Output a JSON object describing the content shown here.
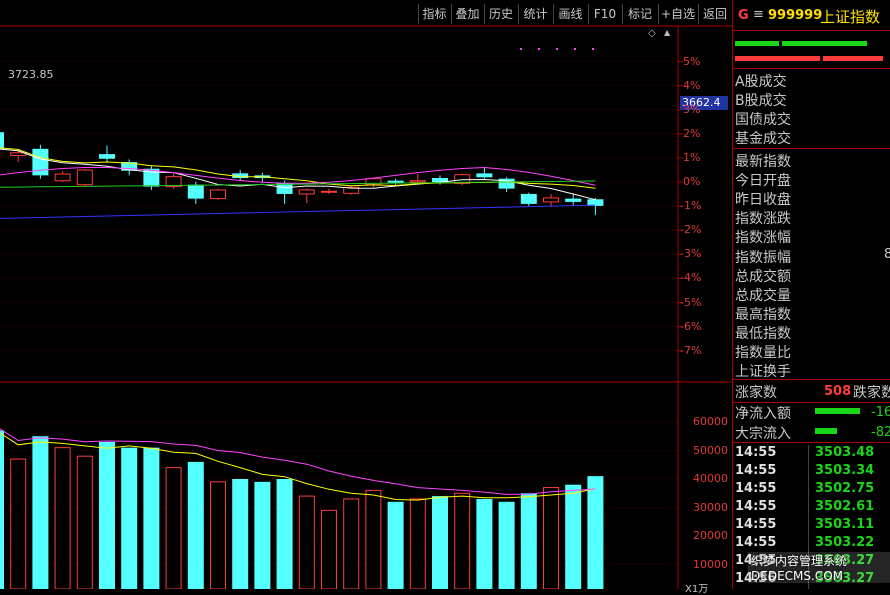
{
  "toolbar": {
    "buttons": [
      "指标",
      "叠加",
      "历史",
      "统计",
      "画线",
      "F10",
      "标记",
      "+自选",
      "返回"
    ]
  },
  "symbol": {
    "g_icon": "G",
    "menu_icon": "≡",
    "code": "999999",
    "name": "上证指数"
  },
  "main_chart": {
    "high_label": "3723.85",
    "price_tag": "3662.4",
    "pct_ticks": [
      "5%",
      "4%",
      "3%",
      "2%",
      "1%",
      "0%",
      "-1%",
      "-2%",
      "-3%",
      "-4%",
      "-5%",
      "-6%",
      "-7%"
    ]
  },
  "volume_chart": {
    "ticks": [
      "60000",
      "50000",
      "40000",
      "30000",
      "20000",
      "10000"
    ],
    "unit": "X1万"
  },
  "side_panel": {
    "turnover_labels": [
      "A股成交",
      "B股成交",
      "国债成交",
      "基金成交"
    ],
    "stat_labels": [
      "最新指数",
      "今日开盘",
      "昨日收盘",
      "指数涨跌",
      "指数涨幅",
      "指数振幅",
      "总成交额",
      "总成交量",
      "最高指数",
      "最低指数",
      "指数量比",
      "上证换手"
    ],
    "amplitude_partial": "8",
    "advance_label": "涨家数",
    "advance_value": "508",
    "decline_label": "跌家数",
    "net_inflow_label": "净流入额",
    "net_inflow_value": "-16",
    "block_inflow_label": "大宗流入",
    "block_inflow_value": "-82",
    "ticks": [
      {
        "time": "14:55",
        "value": "3503.48"
      },
      {
        "time": "14:55",
        "value": "3503.34"
      },
      {
        "time": "14:55",
        "value": "3502.75"
      },
      {
        "time": "14:55",
        "value": "3502.61"
      },
      {
        "time": "14:55",
        "value": "3503.11"
      },
      {
        "time": "14:55",
        "value": "3503.22"
      },
      {
        "time": "14:55",
        "value": "3503.27"
      },
      {
        "time": "14:56",
        "value": "3503.27"
      }
    ]
  },
  "watermark": "织梦内容管理系统 DEDECMS.COM",
  "colors": {
    "up": "#ff3c3c",
    "down": "#54ffff",
    "ma5": "#ffffff",
    "ma10": "#ffff00",
    "ma20": "#ff44ff",
    "ma60": "#22cc22",
    "ma120": "#3333ff"
  },
  "candles": [
    {
      "o": 3705,
      "c": 3680,
      "h": 3723,
      "l": 3670
    },
    {
      "o": 3670,
      "c": 3674,
      "h": 3680,
      "l": 3660
    },
    {
      "o": 3680,
      "c": 3640,
      "h": 3686,
      "l": 3635
    },
    {
      "o": 3632,
      "c": 3642,
      "h": 3646,
      "l": 3630
    },
    {
      "o": 3626,
      "c": 3648,
      "h": 3650,
      "l": 3624
    },
    {
      "o": 3672,
      "c": 3665,
      "h": 3685,
      "l": 3660
    },
    {
      "o": 3660,
      "c": 3647,
      "h": 3664,
      "l": 3640
    },
    {
      "o": 3650,
      "c": 3623,
      "h": 3655,
      "l": 3618
    },
    {
      "o": 3623,
      "c": 3638,
      "h": 3642,
      "l": 3620
    },
    {
      "o": 3626,
      "c": 3605,
      "h": 3630,
      "l": 3597
    },
    {
      "o": 3605,
      "c": 3618,
      "h": 3620,
      "l": 3603
    },
    {
      "o": 3643,
      "c": 3636,
      "h": 3648,
      "l": 3632
    },
    {
      "o": 3640,
      "c": 3636,
      "h": 3644,
      "l": 3630
    },
    {
      "o": 3628,
      "c": 3612,
      "h": 3632,
      "l": 3597
    },
    {
      "o": 3612,
      "c": 3618,
      "h": 3620,
      "l": 3598
    },
    {
      "o": 3615,
      "c": 3616,
      "h": 3620,
      "l": 3612
    },
    {
      "o": 3613,
      "c": 3622,
      "h": 3624,
      "l": 3611
    },
    {
      "o": 3626,
      "c": 3635,
      "h": 3637,
      "l": 3622
    },
    {
      "o": 3632,
      "c": 3629,
      "h": 3635,
      "l": 3624
    },
    {
      "o": 3630,
      "c": 3632,
      "h": 3642,
      "l": 3626
    },
    {
      "o": 3636,
      "c": 3630,
      "h": 3640,
      "l": 3626
    },
    {
      "o": 3628,
      "c": 3641,
      "h": 3643,
      "l": 3625
    },
    {
      "o": 3643,
      "c": 3637,
      "h": 3652,
      "l": 3635
    },
    {
      "o": 3635,
      "c": 3620,
      "h": 3637,
      "l": 3615
    },
    {
      "o": 3612,
      "c": 3597,
      "h": 3614,
      "l": 3594
    },
    {
      "o": 3600,
      "c": 3606,
      "h": 3612,
      "l": 3592
    },
    {
      "o": 3605,
      "c": 3600,
      "h": 3612,
      "l": 3595
    },
    {
      "o": 3604,
      "c": 3594,
      "h": 3606,
      "l": 3580
    }
  ],
  "volumes": [
    57000,
    47000,
    55000,
    51000,
    48000,
    53000,
    51000,
    51000,
    44000,
    46000,
    39000,
    40000,
    39000,
    40000,
    34000,
    29000,
    33000,
    36000,
    32000,
    33000,
    34000,
    35000,
    33000,
    32000,
    35000,
    37000,
    38000,
    41000
  ]
}
